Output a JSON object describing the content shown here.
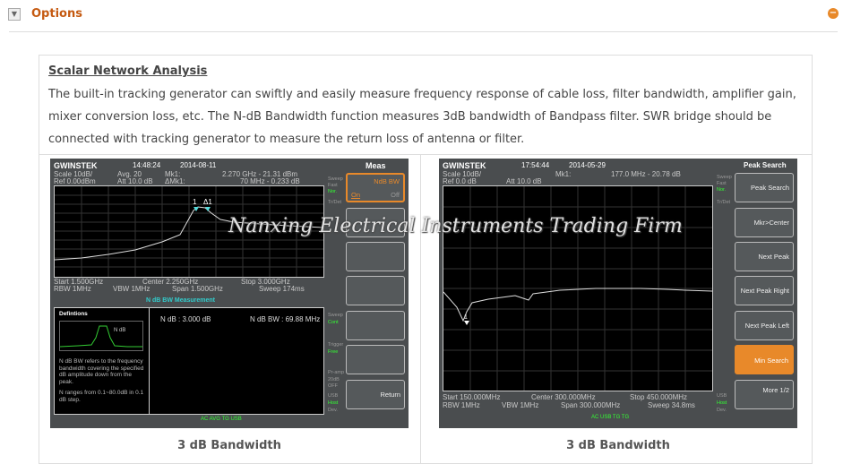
{
  "header": {
    "title": "Options",
    "toggle_icon": "chevron-down-icon",
    "collapse_icon": "minus-circle-icon",
    "accent": "#c55a11"
  },
  "section": {
    "title": "Scalar Network Analysis",
    "description": "The built-in tracking generator can swiftly and easily measure frequency response of cable loss, filter bandwidth, amplifier gain, mixer conversion loss, etc. The N-dB Bandwidth function measures 3dB bandwidth of Bandpass filter. SWR bridge should be connected with tracking generator to measure the return loss of antenna or filter."
  },
  "watermark": "Nanxing Electrical Instruments Trading Firm",
  "left": {
    "caption": "3 dB Bandwidth",
    "brand": "GWINSTEK",
    "time": "14:48:24",
    "date": "2014-08-11",
    "scale": "Scale 10dB/",
    "ref": "Ref 0.00dBm",
    "avg": "Avg. 20",
    "att": "Att 10.0 dB",
    "mk1": "Mk1:",
    "dmk1": "ΔMk1:",
    "mk1_val": "2.270 GHz - 21.31 dBm",
    "dmk1_val": "70 MHz - 0.233 dB",
    "markers": [
      "1",
      "Δ1"
    ],
    "start": "Start 1.500GHz",
    "center": "Center 2.250GHz",
    "stop": "Stop 3.000GHz",
    "rbw": "RBW 1MHz",
    "vbw": "VBW 1MHz",
    "span": "Span 1.500GHz",
    "sweep": "Sweep 174ms",
    "meas_title": "N dB BW Measurement",
    "def_title": "Defintions",
    "def_ndb": "N dB",
    "def_text1": "N dB BW refers to the frequency bandwidth covering the specified dB amplitude down from the peak.",
    "def_text2": "N ranges from 0.1~80.0dB in 0.1 dB step.",
    "ndb": "N dB : 3.000 dB",
    "ndb_bw": "N dB BW : 69.88 MHz",
    "menu_title": "Meas",
    "softkeys": [
      "NdB BW",
      "",
      "",
      "",
      "",
      "",
      "Return"
    ],
    "ndb_on": "On",
    "ndb_off": "Off",
    "side": [
      "Sweep",
      "Fast",
      "Nor.",
      "Tr/Det",
      "Sweep",
      "Cont",
      "Trigger",
      "Free",
      "Pr-amp",
      "20dB",
      "OFF",
      "USB",
      "Host",
      "Dev."
    ],
    "status": "AC AVG TG USB"
  },
  "right": {
    "caption": "3 dB Bandwidth",
    "brand": "GWINSTEK",
    "time": "17:54:44",
    "date": "2014-05-29",
    "scale": "Scale 10dB/",
    "ref": "Ref 0.0 dB",
    "att": "Att 10.0 dB",
    "mk1": "Mk1:",
    "mk1_val": "177.0 MHz - 20.78 dB",
    "marker": "1",
    "start": "Start 150.000MHz",
    "center": "Center 300.000MHz",
    "stop": "Stop 450.000MHz",
    "rbw": "RBW 1MHz",
    "vbw": "VBW 1MHz",
    "span": "Span 300.000MHz",
    "sweep": "Sweep 34.8ms",
    "menu_title": "Peak Search",
    "softkeys": [
      "Peak Search",
      "Mkr>Center",
      "Next Peak",
      "Next Peak Right",
      "Next Peak Left",
      "Min Search",
      "More 1/2"
    ],
    "side": [
      "Sweep",
      "Fast",
      "Nor.",
      "Tr/Det",
      "USB",
      "Host",
      "Dev."
    ],
    "status": "AC USB TG TG"
  }
}
